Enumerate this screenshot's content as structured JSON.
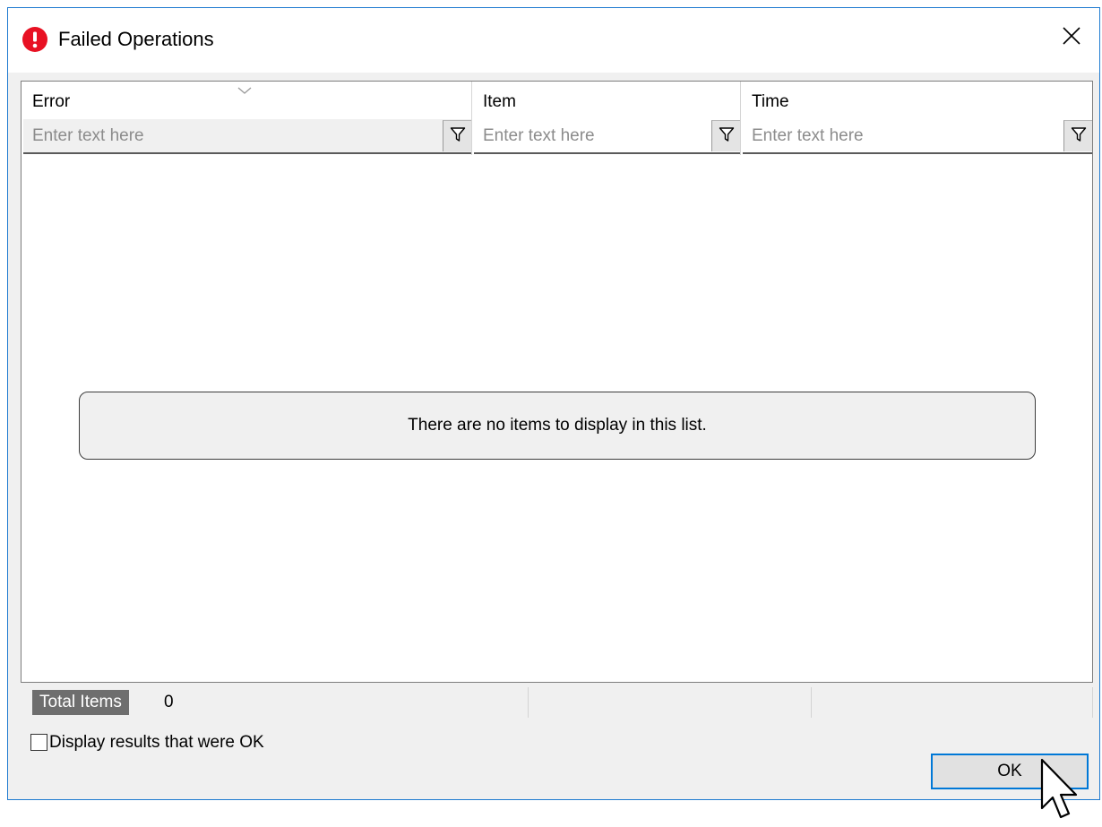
{
  "window": {
    "title": "Failed Operations",
    "title_icon": "error-icon",
    "close_icon": "close-icon",
    "accent_color": "#0078d7",
    "error_color": "#e81123"
  },
  "list": {
    "columns": [
      {
        "label": "Error",
        "filter_placeholder": "Enter text here",
        "sorted": true
      },
      {
        "label": "Item",
        "filter_placeholder": "Enter text here"
      },
      {
        "label": "Time",
        "filter_placeholder": "Enter text here"
      }
    ],
    "empty_message": "There are no items to display in this list."
  },
  "status": {
    "total_label": "Total Items",
    "total_value": "0"
  },
  "options": {
    "show_ok_label": "Display results that were OK",
    "show_ok_checked": false
  },
  "buttons": {
    "ok_label": "OK"
  }
}
